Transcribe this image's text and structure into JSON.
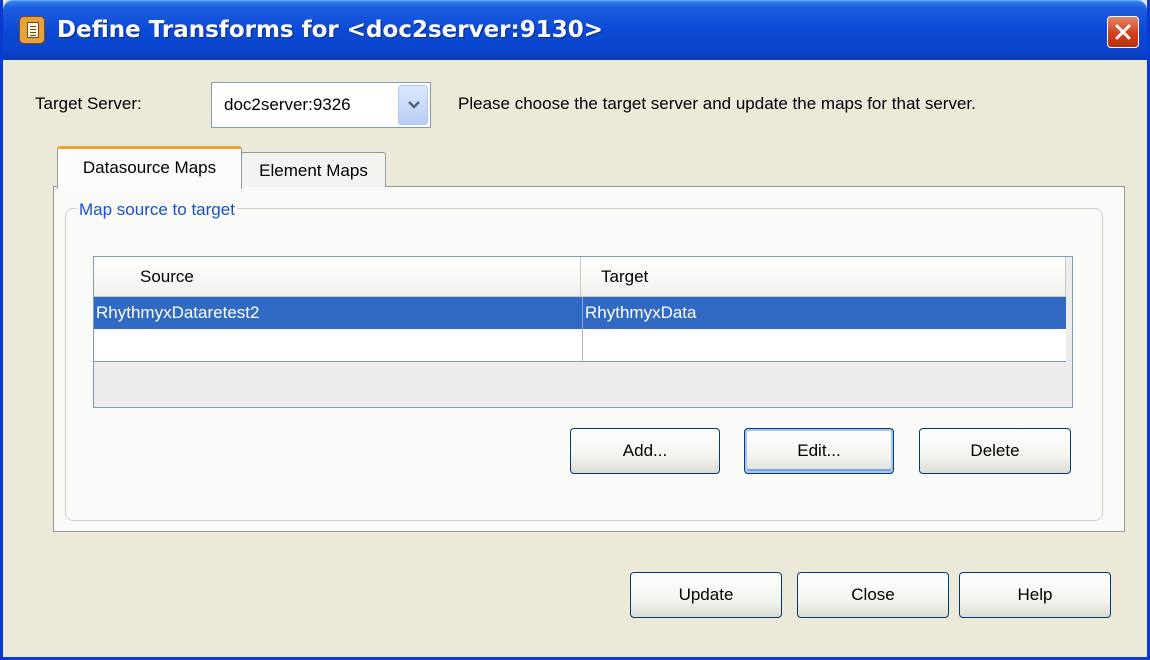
{
  "window": {
    "title": "Define Transforms for <doc2server:9130>"
  },
  "target_server": {
    "label": "Target Server:",
    "selected": "doc2server:9326",
    "hint": "Please choose the target server and update the maps for that server."
  },
  "tabs": [
    {
      "label": "Datasource Maps",
      "active": true
    },
    {
      "label": "Element Maps",
      "active": false
    }
  ],
  "group": {
    "title": "Map source to target"
  },
  "table": {
    "columns": [
      "Source",
      "Target"
    ],
    "rows": [
      {
        "source": "RhythmyxDataretest2",
        "target": "RhythmyxData",
        "selected": true
      }
    ]
  },
  "map_buttons": {
    "add": "Add...",
    "edit": "Edit...",
    "delete": "Delete"
  },
  "dialog_buttons": {
    "update": "Update",
    "close": "Close",
    "help": "Help"
  },
  "colors": {
    "titlebar": "#0b4ad6",
    "selection": "#316ac5",
    "active_tab_accent": "#f2a528",
    "group_title": "#1a4fcf"
  }
}
